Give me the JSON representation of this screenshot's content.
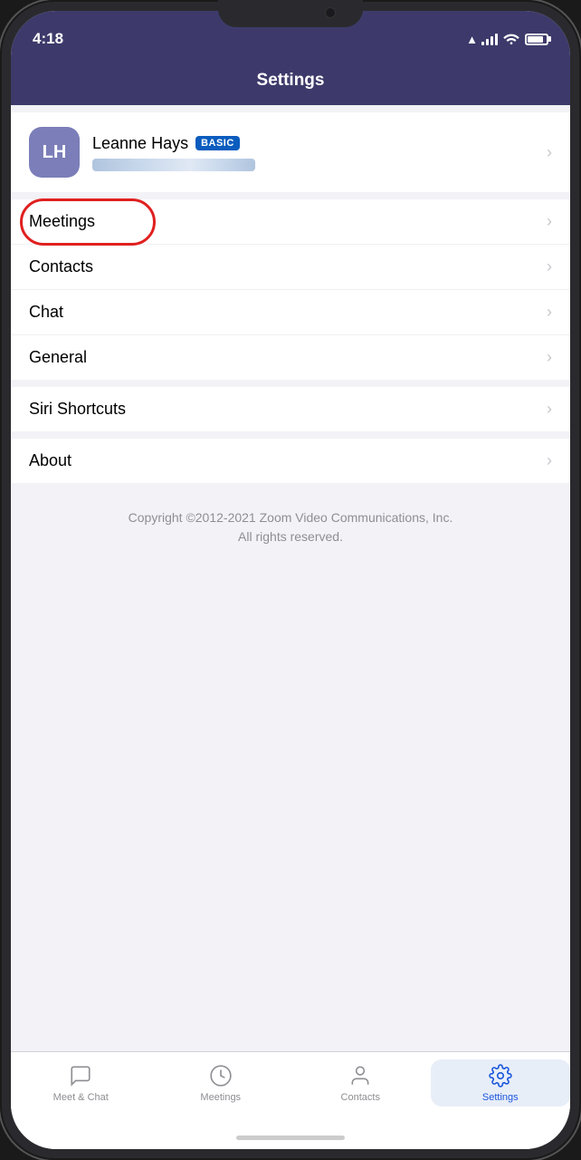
{
  "statusBar": {
    "time": "4:18",
    "locationArrow": "▶"
  },
  "header": {
    "title": "Settings"
  },
  "profile": {
    "initials": "LH",
    "name": "Leanne Hays",
    "badge": "BASIC"
  },
  "menuSections": [
    {
      "items": [
        {
          "id": "meetings",
          "label": "Meetings",
          "highlighted": true
        },
        {
          "id": "contacts",
          "label": "Contacts",
          "highlighted": false
        },
        {
          "id": "chat",
          "label": "Chat",
          "highlighted": false
        },
        {
          "id": "general",
          "label": "General",
          "highlighted": false
        }
      ]
    },
    {
      "items": [
        {
          "id": "siri-shortcuts",
          "label": "Siri Shortcuts",
          "highlighted": false
        }
      ]
    },
    {
      "items": [
        {
          "id": "about",
          "label": "About",
          "highlighted": false
        }
      ]
    }
  ],
  "copyright": "Copyright ©2012-2021 Zoom Video Communications, Inc.\nAll rights reserved.",
  "tabBar": {
    "tabs": [
      {
        "id": "meet-chat",
        "label": "Meet & Chat",
        "active": false
      },
      {
        "id": "meetings",
        "label": "Meetings",
        "active": false
      },
      {
        "id": "contacts",
        "label": "Contacts",
        "active": false
      },
      {
        "id": "settings",
        "label": "Settings",
        "active": true
      }
    ]
  }
}
